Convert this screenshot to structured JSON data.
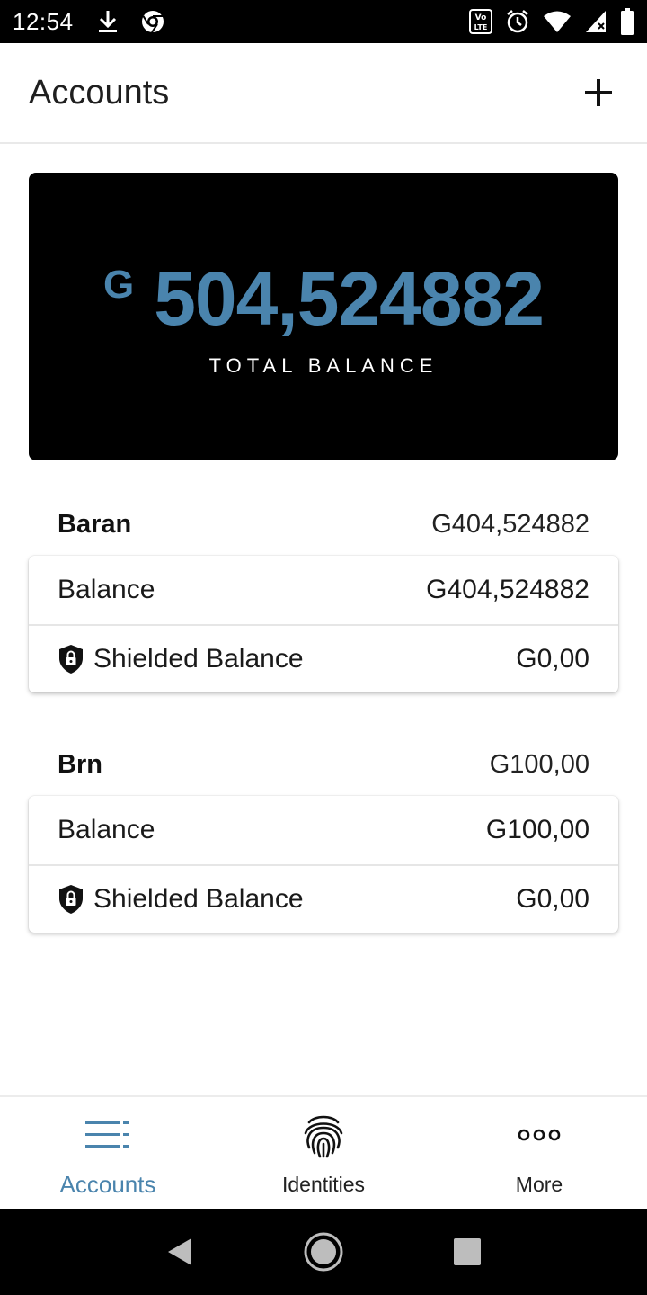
{
  "status_bar": {
    "time": "12:54",
    "left_icons": [
      "download-icon",
      "chrome-icon"
    ],
    "right_icons": [
      "volte-icon",
      "alarm-icon",
      "wifi-icon",
      "signal-icon",
      "battery-icon"
    ],
    "volte_text": "VoLTE"
  },
  "header": {
    "title": "Accounts",
    "add_icon": "plus-icon"
  },
  "total": {
    "currency": "G",
    "amount": "504,524882",
    "label": "TOTAL BALANCE",
    "accent_color": "#4a84ad"
  },
  "accounts": [
    {
      "name": "Baran",
      "total": "G404,524882",
      "balance_label": "Balance",
      "balance_value": "G404,524882",
      "shielded_label": "Shielded Balance",
      "shielded_value": "G0,00"
    },
    {
      "name": "Brn",
      "total": "G100,00",
      "balance_label": "Balance",
      "balance_value": "G100,00",
      "shielded_label": "Shielded Balance",
      "shielded_value": "G0,00"
    }
  ],
  "bottom_nav": {
    "items": [
      {
        "label": "Accounts",
        "icon": "accounts-list-icon",
        "active": true
      },
      {
        "label": "Identities",
        "icon": "fingerprint-icon",
        "active": false
      },
      {
        "label": "More",
        "icon": "more-dots-icon",
        "active": false
      }
    ]
  },
  "android_nav": [
    "back-icon",
    "home-icon",
    "recents-icon"
  ]
}
